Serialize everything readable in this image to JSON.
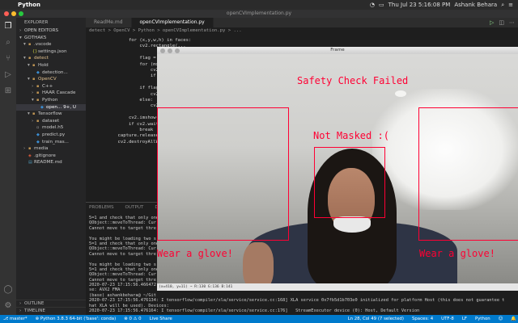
{
  "menubar": {
    "app": "Python",
    "clock": "Thu Jul 23  5:16:08 PM",
    "user": "Ashank Behara"
  },
  "vscode_title": "openCVImplementation.py",
  "sidebar": {
    "explorer": "EXPLORER",
    "open_editors": "OPEN EDITORS",
    "root": "GOTHAK5",
    "items": [
      {
        "label": ".vscode",
        "arrow": "▾",
        "indent": 1,
        "icon": "folder"
      },
      {
        "label": "settings.json",
        "arrow": "",
        "indent": 2,
        "icon": "json"
      },
      {
        "label": "detect",
        "arrow": "▾",
        "indent": 1,
        "icon": "folder",
        "accent": true
      },
      {
        "label": "Hold",
        "arrow": "▾",
        "indent": 2,
        "icon": "folder"
      },
      {
        "label": "detection...",
        "arrow": "",
        "indent": 3,
        "icon": "py"
      },
      {
        "label": "OpenCV",
        "arrow": "▾",
        "indent": 2,
        "icon": "folder",
        "accent": true
      },
      {
        "label": "C++",
        "arrow": "›",
        "indent": 3,
        "icon": "folder"
      },
      {
        "label": "HAAR Cascade",
        "arrow": "›",
        "indent": 3,
        "icon": "folder"
      },
      {
        "label": "Python",
        "arrow": "▾",
        "indent": 3,
        "icon": "folder"
      },
      {
        "label": "open... 9+, U",
        "arrow": "",
        "indent": 4,
        "icon": "py",
        "selected": true
      },
      {
        "label": "Tensorflow",
        "arrow": "▾",
        "indent": 2,
        "icon": "folder"
      },
      {
        "label": "dataset",
        "arrow": "›",
        "indent": 3,
        "icon": "folder"
      },
      {
        "label": "model.h5",
        "arrow": "",
        "indent": 3,
        "icon": "file"
      },
      {
        "label": "predict.py",
        "arrow": "",
        "indent": 3,
        "icon": "py"
      },
      {
        "label": "train_mas...",
        "arrow": "",
        "indent": 3,
        "icon": "py"
      },
      {
        "label": "media",
        "arrow": "›",
        "indent": 1,
        "icon": "folder"
      },
      {
        "label": ".gitignore",
        "arrow": "",
        "indent": 1,
        "icon": "git"
      },
      {
        "label": "README.md",
        "arrow": "",
        "indent": 1,
        "icon": "md"
      }
    ],
    "outline": "OUTLINE",
    "timeline": "TIMELINE"
  },
  "tabs": [
    {
      "label": "ReadMe.md",
      "active": false
    },
    {
      "label": "openCVImplementation.py",
      "active": true
    }
  ],
  "breadcrumb": "detect > OpenCV > Python > openCVImplementation.py > ...",
  "code": [
    {
      "ln": "",
      "text": "        for (x,y,w,h) in faces:"
    },
    {
      "ln": "",
      "text": "            cv2.rectangle(..."
    },
    {
      "ln": "",
      "text": ""
    },
    {
      "ln": "",
      "text": "            flag = false"
    },
    {
      "ln": "",
      "text": "            for (mx,my,m..."
    },
    {
      "ln": "",
      "text": "                cv2.rec..."
    },
    {
      "ln": "",
      "text": "                if (mx..."
    },
    {
      "ln": "",
      "text": "                    fla..."
    },
    {
      "ln": "",
      "text": "            if flag:"
    },
    {
      "ln": "",
      "text": "                cv2.put..."
    },
    {
      "ln": "",
      "text": "            else:"
    },
    {
      "ln": "",
      "text": "                cv2.put..."
    },
    {
      "ln": "",
      "text": ""
    },
    {
      "ln": "",
      "text": "        cv2.imshow(\"Fra..."
    },
    {
      "ln": "",
      "text": "        if cv2.waitKey(..."
    },
    {
      "ln": "",
      "text": "            break"
    },
    {
      "ln": "",
      "text": "    capture.release()"
    },
    {
      "ln": "",
      "text": "    cv2.destroyAllWindo..."
    }
  ],
  "panel": {
    "tabs": [
      "PROBLEMS",
      "OUTPUT",
      "DEBUG CONSOLE",
      "TERMINAL"
    ],
    "active": "TERMINAL",
    "lines": [
      "5=1 and check that only one",
      "QObject::moveToThread: Cur",
      "Cannot move to target thre",
      "",
      "You might be loading two s",
      "5=1 and check that only one",
      "QObject::moveToThread: Cur",
      "Cannot move to target thre",
      "",
      "You might be loading two s",
      "5=1 and check that only one",
      "QObject::moveToThread: Cur",
      "Cannot move to target thre",
      "2020-07-23 17:15:56.466472",
      "se: AVX2 FMA",
      "(base) ashankbehara@ ~/Git",
      "2020-07-23 17:15:56.476134: I tensorflow/compiler/xla/service/service.cc:168] XLA service 0x7fb5d1b703e0 initialized for platform Host (this does not guarantee t",
      "hat XLA will be used). Devices:",
      "2020-07-23 17:15:56.476164: I tensorflow/compiler/xla/service/service.cc:176]   StreamExecutor device (0): Host, Default Version"
    ]
  },
  "statusbar": {
    "left": [
      "⎇ master*",
      "⊗ Python 3.8.3 64-bit ('base': conda)",
      "⊗ 0 ⚠ 0",
      "Live Share"
    ],
    "right": [
      "Ln 28, Col 49 (7 selected)",
      "Spaces: 4",
      "UTF-8",
      "LF",
      "Python",
      "☺",
      "🔔"
    ]
  },
  "frame": {
    "title": "Frame",
    "labels": {
      "safety": "Safety Check Failed",
      "mask": "Not Masked :(",
      "glove_left": "Wear a glove!",
      "glove_right": "Wear a glove!"
    },
    "status": "(x=410, y=11) ~ R:130 G:136 B:141"
  },
  "colors": {
    "accent": "#007acc",
    "detection": "#ff0033"
  }
}
